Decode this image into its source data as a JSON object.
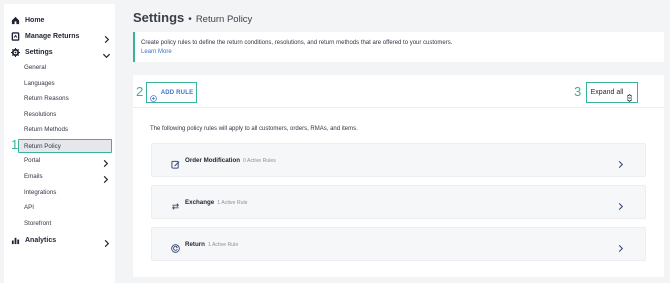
{
  "sidebar": {
    "items": [
      {
        "label": "Home",
        "icon": "home-icon",
        "has_chevron": false
      },
      {
        "label": "Manage Returns",
        "icon": "returns-icon",
        "has_chevron": true
      },
      {
        "label": "Settings",
        "icon": "gear-icon",
        "has_chevron": true,
        "expanded": true
      }
    ],
    "sub_items": [
      {
        "label": "General"
      },
      {
        "label": "Languages"
      },
      {
        "label": "Return Reasons"
      },
      {
        "label": "Resolutions"
      },
      {
        "label": "Return Methods"
      },
      {
        "label": "Return Policy",
        "active": true
      },
      {
        "label": "Portal",
        "has_chevron": true
      },
      {
        "label": "Emails",
        "has_chevron": true
      },
      {
        "label": "Integrations"
      },
      {
        "label": "API"
      },
      {
        "label": "Storefront"
      }
    ],
    "analytics": {
      "label": "Analytics",
      "icon": "bar-chart-icon",
      "has_chevron": true
    }
  },
  "header": {
    "title": "Settings",
    "separator": "•",
    "subtitle": "Return Policy"
  },
  "info": {
    "text": "Create policy rules to define the return conditions, resolutions, and return methods that are offered to your customers.",
    "link": "Learn More"
  },
  "toolbar": {
    "add_rule_label": "ADD RULE",
    "expand_all_label": "Expand all"
  },
  "callouts": {
    "one": "1",
    "two": "2",
    "three": "3"
  },
  "intro": "The following policy rules will apply to all customers, orders, RMAs, and items.",
  "rules": [
    {
      "name": "Order Modification",
      "meta": "0 Active Rules",
      "icon": "edit-icon"
    },
    {
      "name": "Exchange",
      "meta": "1 Active Rule",
      "icon": "exchange-icon"
    },
    {
      "name": "Return",
      "meta": "1 Active Rule",
      "icon": "return-icon"
    }
  ],
  "colors": {
    "accent": "#3ab39a",
    "link": "#3a74c9",
    "text": "#1e2433"
  }
}
